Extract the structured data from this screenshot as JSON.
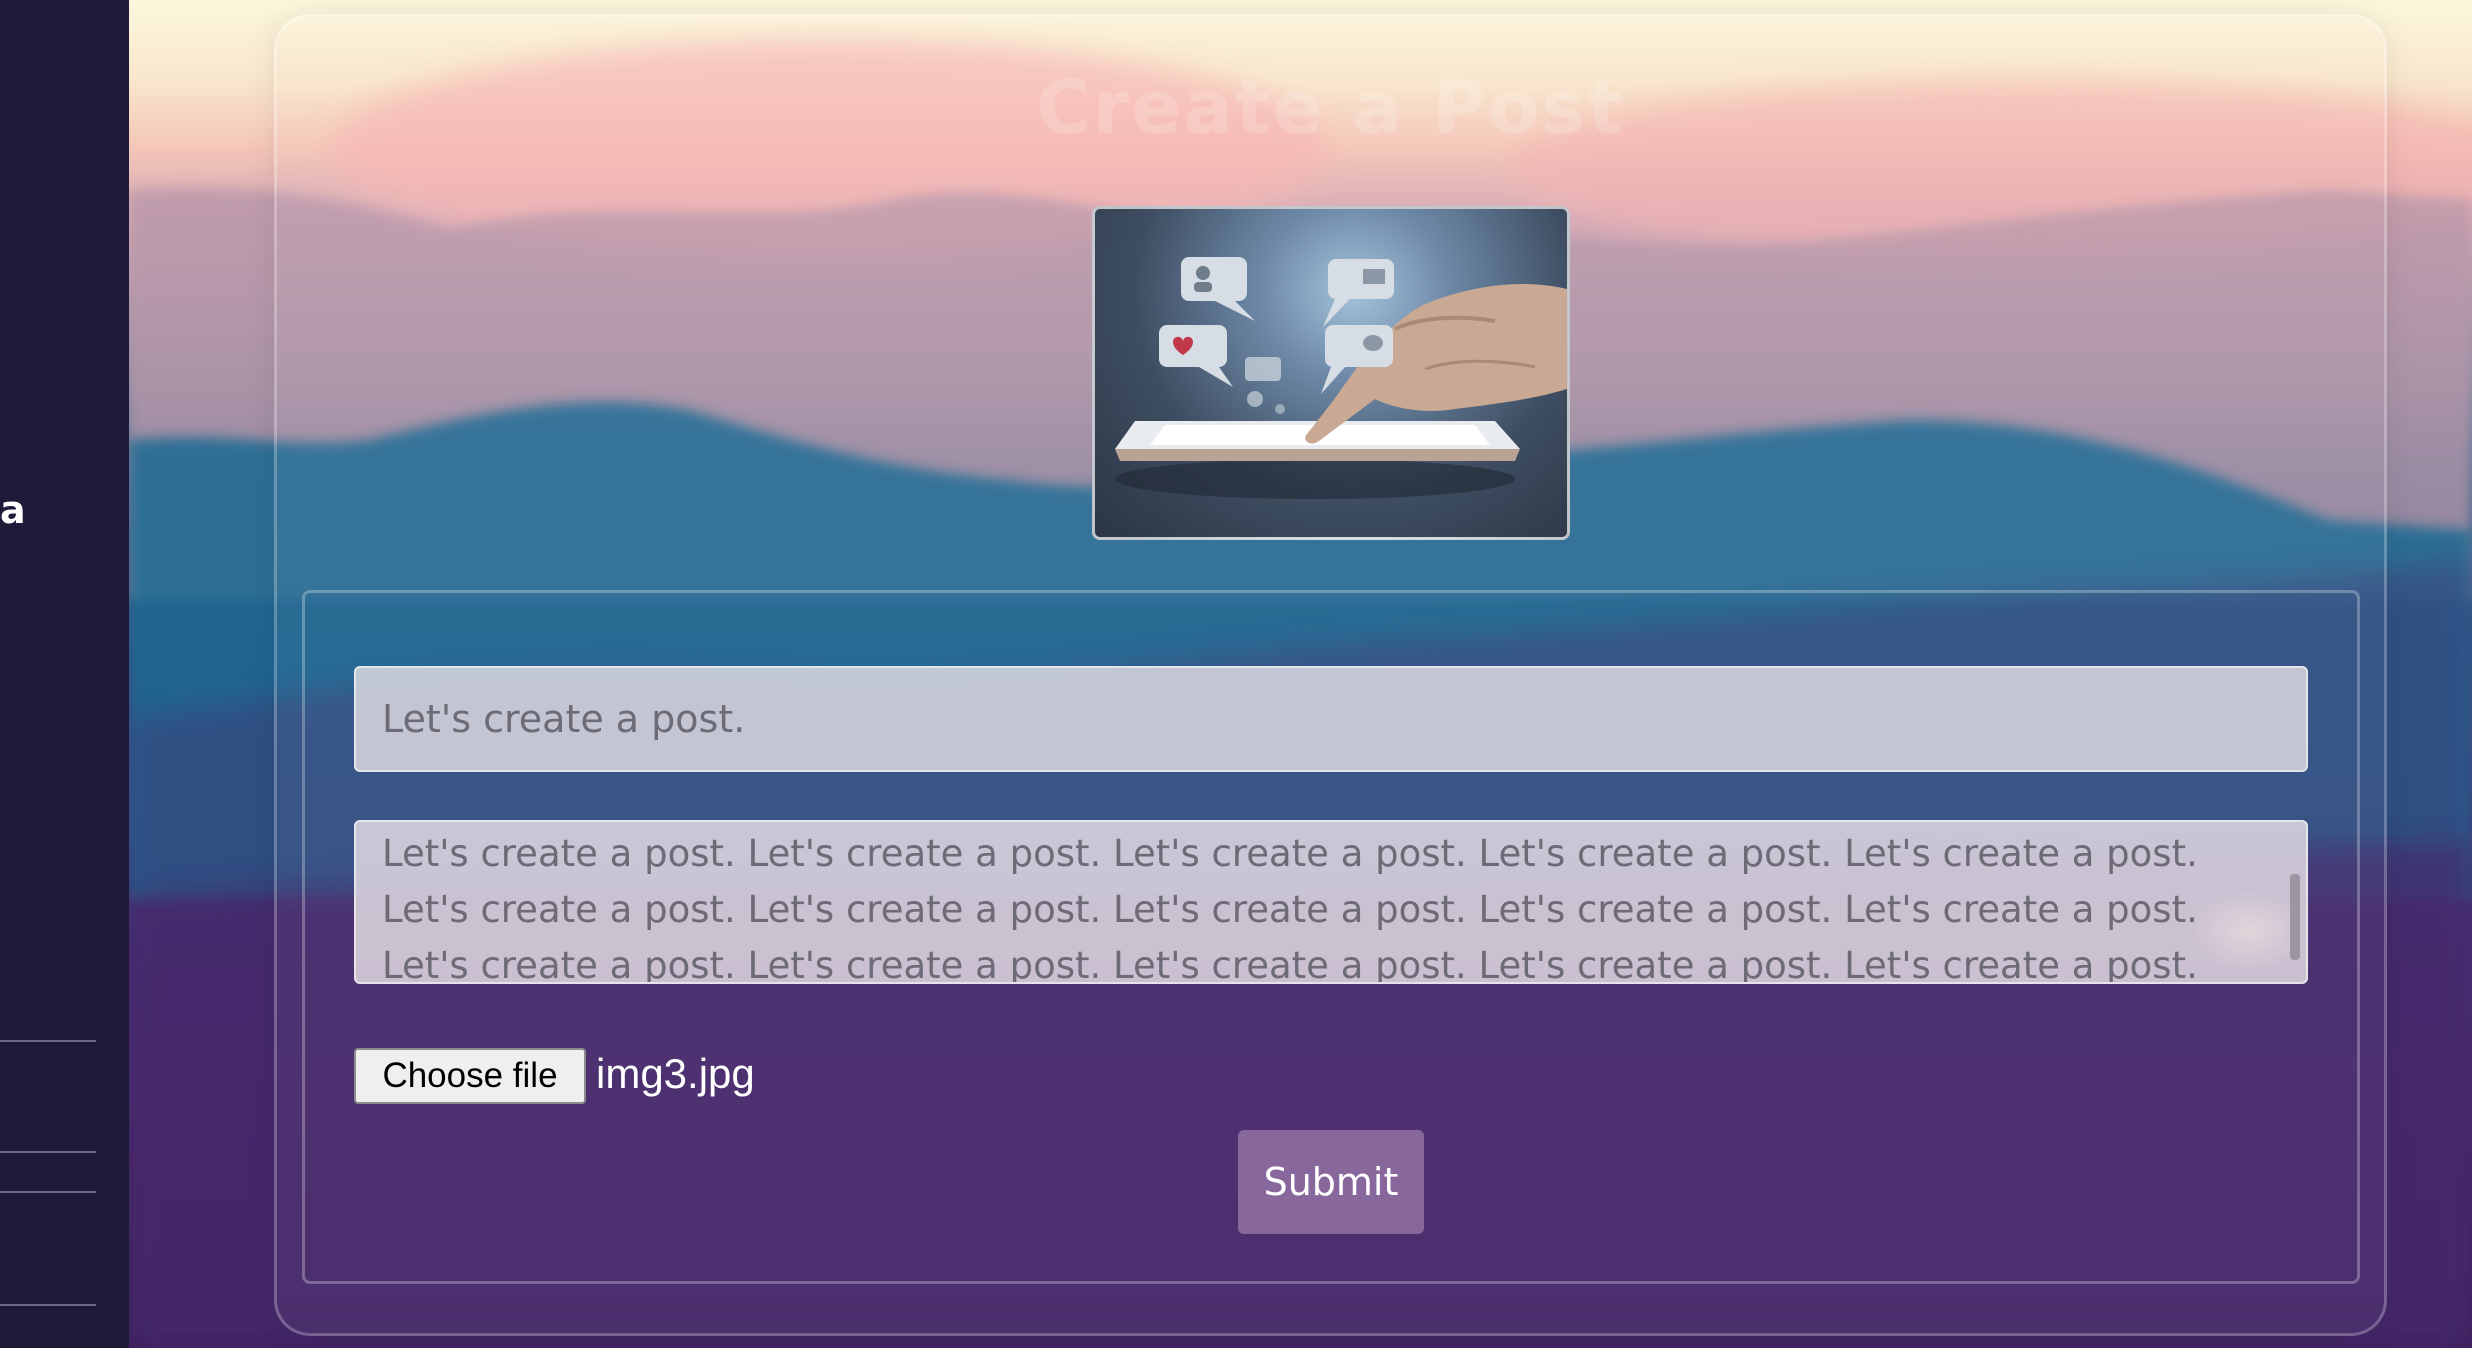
{
  "sidebar": {
    "partial_text": "a"
  },
  "card": {
    "title": "Create a Post"
  },
  "form": {
    "title_placeholder": "Let's create a post.",
    "body_text": "Let's create a post. Let's create a post. Let's create a post. Let's create a post. Let's create a post. Let's create a post. Let's create a post. Let's create a post. Let's create a post. Let's create a post. Let's create a post. Let's create a post. Let's create a post. Let's create a post. Let's create a post.",
    "file_button_label": "Choose file",
    "file_name": "img3.jpg",
    "submit_label": "Submit"
  },
  "colors": {
    "sidebar_bg": "#1e1a37",
    "accent_submit": "#b996c3",
    "heart": "#c0394a"
  },
  "icons": [
    "user-icon",
    "mail-icon",
    "heart-icon",
    "chat-icon",
    "tablet-hand-image"
  ]
}
